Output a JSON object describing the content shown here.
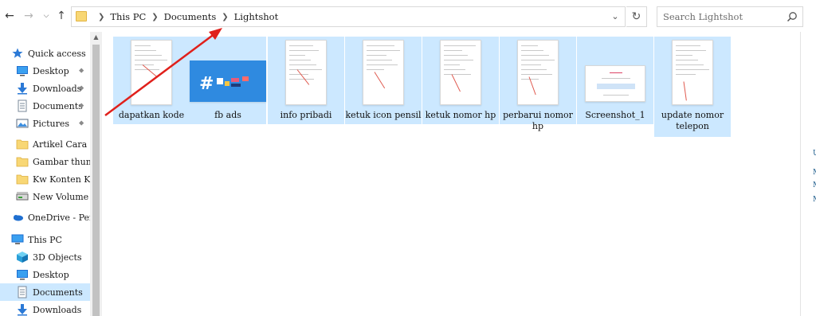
{
  "navigation": {
    "back_icon": "arrow-left-icon",
    "forward_icon": "arrow-right-icon",
    "recent_icon": "chevron-down-icon",
    "up_icon": "arrow-up-icon"
  },
  "address": {
    "crumbs": [
      "This PC",
      "Documents",
      "Lightshot"
    ],
    "dropdown_icon": "chevron-down-icon",
    "refresh_icon": "refresh-icon"
  },
  "search": {
    "placeholder": "Search Lightshot",
    "icon": "search-icon"
  },
  "sidebar": {
    "items": [
      {
        "label": "Quick access",
        "icon": "star-icon",
        "pinned": false
      },
      {
        "label": "Desktop",
        "icon": "desktop-icon",
        "pinned": true
      },
      {
        "label": "Downloads",
        "icon": "download-icon",
        "pinned": true
      },
      {
        "label": "Documents",
        "icon": "document-icon",
        "pinned": true
      },
      {
        "label": "Pictures",
        "icon": "pictures-icon",
        "pinned": true
      },
      {
        "label": "Artikel Cara",
        "icon": "folder-icon",
        "pinned": false
      },
      {
        "label": "Gambar thumbn",
        "icon": "folder-icon",
        "pinned": false
      },
      {
        "label": "Kw Konten Ku",
        "icon": "folder-icon",
        "pinned": false
      },
      {
        "label": "New Volume (G",
        "icon": "drive-icon",
        "pinned": false
      },
      {
        "label": "OneDrive - Perso",
        "icon": "cloud-icon",
        "pinned": false
      },
      {
        "label": "This PC",
        "icon": "computer-icon",
        "pinned": false
      },
      {
        "label": "3D Objects",
        "icon": "cube-icon",
        "pinned": false
      },
      {
        "label": "Desktop",
        "icon": "desktop-icon",
        "pinned": false
      },
      {
        "label": "Documents",
        "icon": "document-icon",
        "pinned": false
      },
      {
        "label": "Downloads",
        "icon": "download-icon",
        "pinned": false
      }
    ]
  },
  "files": [
    {
      "name": "dapatkan kode"
    },
    {
      "name": "fb ads"
    },
    {
      "name": "info pribadi"
    },
    {
      "name": "ketuk icon pensil"
    },
    {
      "name": "ketuk nomor hp"
    },
    {
      "name": "perbarui nomor hp"
    },
    {
      "name": "Screenshot_1"
    },
    {
      "name": "update nomor telepon"
    }
  ],
  "edge_letters": [
    "U",
    "M",
    "M",
    "M"
  ],
  "colors": {
    "selection": "#cce8ff",
    "annotation": "#e0201b",
    "fb_ads_bg": "#2f8ae0"
  }
}
